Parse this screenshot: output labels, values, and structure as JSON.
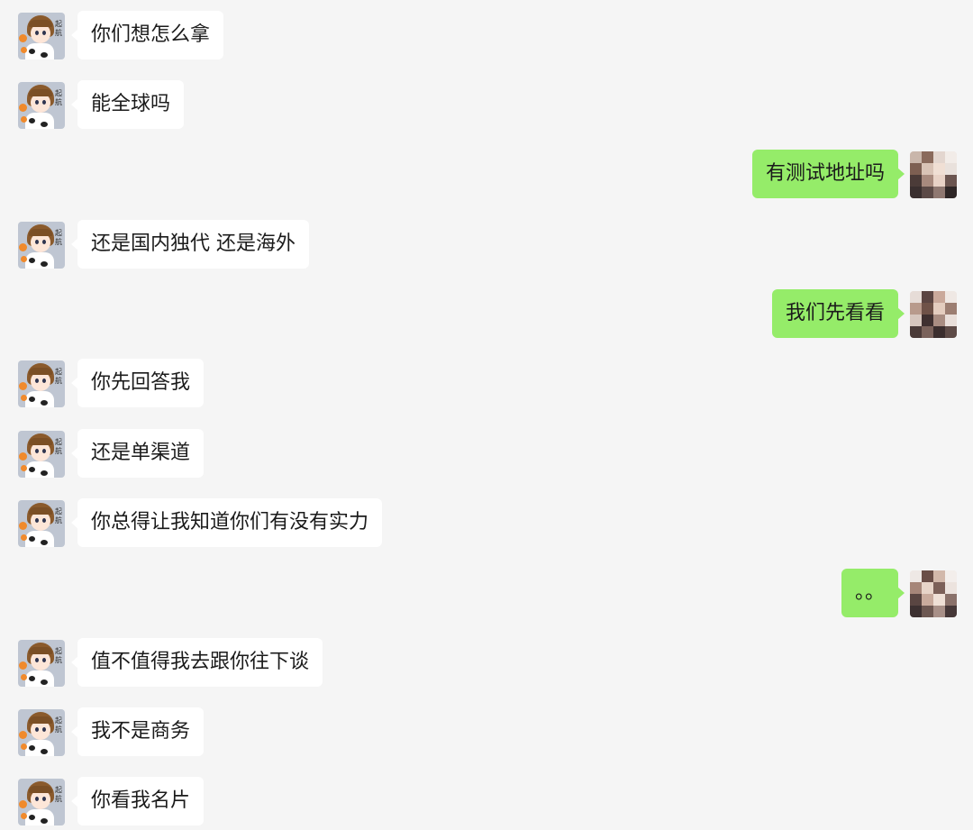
{
  "contact_avatar": {
    "name_stamp": "起航"
  },
  "colors": {
    "background": "#f5f5f5",
    "incoming_bubble": "#ffffff",
    "outgoing_bubble": "#95ec69"
  },
  "messages": [
    {
      "side": "left",
      "text": "你们想怎么拿"
    },
    {
      "side": "left",
      "text": "能全球吗"
    },
    {
      "side": "right",
      "text": "有测试地址吗"
    },
    {
      "side": "left",
      "text": "还是国内独代 还是海外"
    },
    {
      "side": "right",
      "text": "我们先看看"
    },
    {
      "side": "left",
      "text": "你先回答我"
    },
    {
      "side": "left",
      "text": "还是单渠道"
    },
    {
      "side": "left",
      "text": "你总得让我知道你们有没有实力"
    },
    {
      "side": "right",
      "text": "。。"
    },
    {
      "side": "left",
      "text": "值不值得我去跟你往下谈"
    },
    {
      "side": "left",
      "text": "我不是商务"
    },
    {
      "side": "left",
      "text": "你看我名片"
    }
  ]
}
